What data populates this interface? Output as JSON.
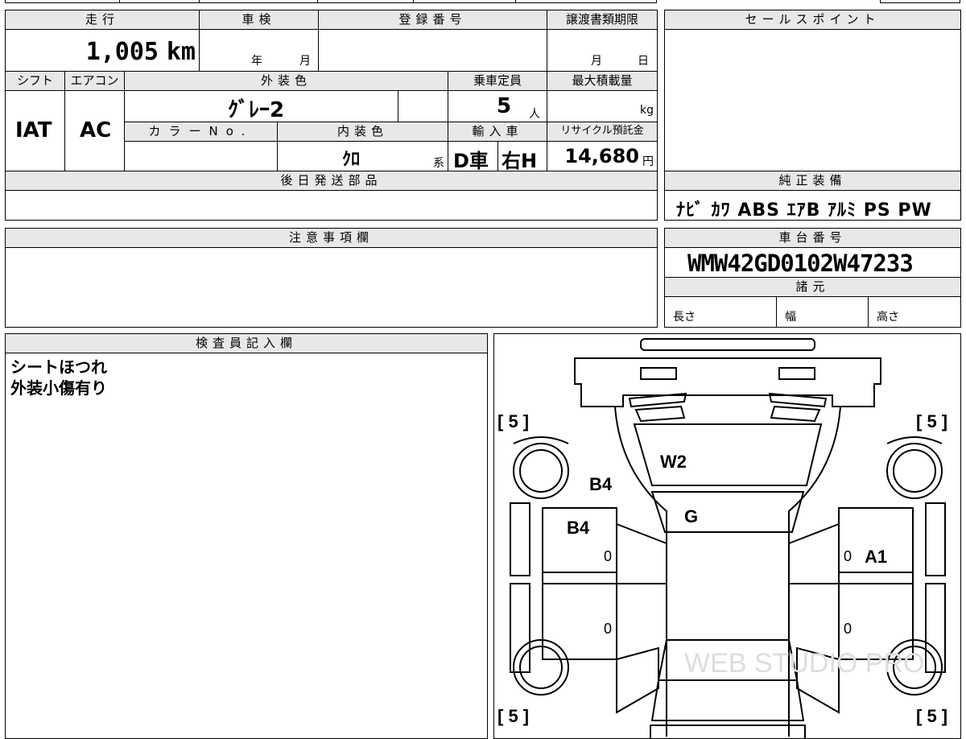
{
  "top_partial": {
    "text1": "",
    "text2": ""
  },
  "mileage": {
    "label": "走行",
    "value": "1,005",
    "unit": "km"
  },
  "shaken": {
    "label": "車検",
    "year_label": "年",
    "month_label": "月"
  },
  "registration": {
    "label": "登録番号",
    "value": ""
  },
  "transfer_deadline": {
    "label": "譲渡書類期限",
    "month_label": "月",
    "day_label": "日"
  },
  "sales_points": {
    "label": "セールスポイント",
    "value": ""
  },
  "shift": {
    "label": "シフト",
    "value": "IAT"
  },
  "aircon": {
    "label": "エアコン",
    "value": "AC"
  },
  "exterior_color": {
    "label": "外装色",
    "value": "ｸﾞﾚｰ2"
  },
  "capacity": {
    "label": "乗車定員",
    "value": "5",
    "unit": "人"
  },
  "max_load": {
    "label": "最大積載量",
    "unit": "kg"
  },
  "color_no": {
    "label": "カラーNo.",
    "value": ""
  },
  "interior_color": {
    "label": "内装色",
    "value": "ｸﾛ",
    "suffix": "系"
  },
  "import": {
    "label": "輸入車",
    "d": "D車",
    "h": "右H"
  },
  "recycle": {
    "label": "リサイクル預託金",
    "value": "14,680",
    "unit": "円"
  },
  "later_parts": {
    "label": "後日発送部品",
    "value": ""
  },
  "equipment": {
    "label": "純正装備",
    "items": "ﾅﾋﾞ ｶﾜ ABS ｴｱB ｱﾙﾐ PS PW"
  },
  "notes": {
    "label": "注意事項欄",
    "value": ""
  },
  "chassis": {
    "label": "車台番号",
    "value": "WMW42GD0102W47233"
  },
  "specs": {
    "label": "諸元",
    "length": "長さ",
    "width": "幅",
    "height": "高さ"
  },
  "inspector": {
    "label": "検査員記入欄",
    "line1": "シートほつれ",
    "line2": "外装小傷有り"
  },
  "diagram": {
    "tire_fl": "[ 5 ]",
    "tire_fr": "[ 5 ]",
    "tire_rl": "[ 5 ]",
    "tire_rr": "[ 5 ]",
    "w2": "W2",
    "g": "G",
    "b4_upper": "B4",
    "b4_door": "B4",
    "a1": "A1",
    "zero_fl": "0",
    "zero_fr": "0",
    "zero_rl": "0",
    "zero_rr": "0",
    "watermark": "WEB STUDIO PRO"
  }
}
